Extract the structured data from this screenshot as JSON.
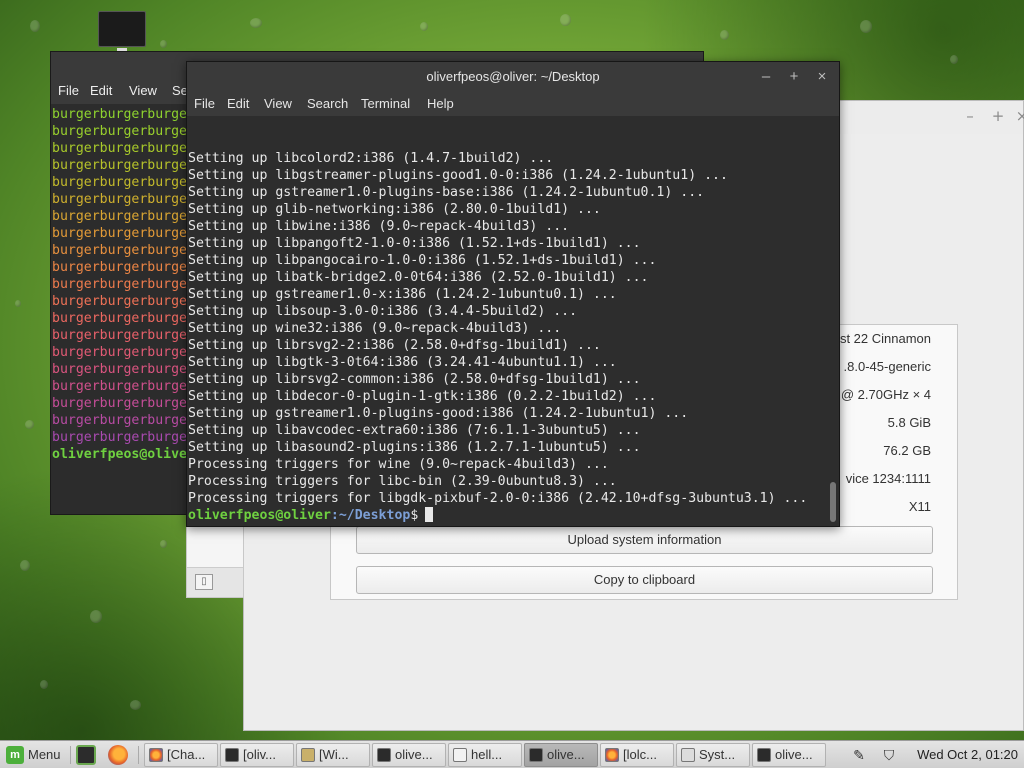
{
  "colors": {
    "accent_green": "#6fd140",
    "path_blue": "#7c9fd6",
    "terminal_bg": "#2d2d2d",
    "panel_bg": "#d9d9d9"
  },
  "sysinfo_window": {
    "rows": [
      "st 22 Cinnamon",
      ".8.0-45-generic",
      "@ 2.70GHz × 4",
      "5.8 GiB",
      "76.2 GB",
      "vice 1234:1111",
      "X11"
    ],
    "upload_label": "Upload system information",
    "copy_label": "Copy to clipboard",
    "minimize_icon": "minimize-icon",
    "maximize_icon": "maximize-icon",
    "close_icon": "close-icon"
  },
  "back_terminal": {
    "menu": [
      "File",
      "Edit",
      "View",
      "Se"
    ],
    "lines": [
      {
        "text": "burgerburgerburge",
        "color": "#8ed32f"
      },
      {
        "text": "burgerburgerburge",
        "color": "#99cf2c"
      },
      {
        "text": "burgerburgerburge",
        "color": "#a8c92a"
      },
      {
        "text": "burgerburgerburge",
        "color": "#b6c22a"
      },
      {
        "text": "burgerburgerburge",
        "color": "#c3ba2b"
      },
      {
        "text": "burgerburgerburge",
        "color": "#cfb02e"
      },
      {
        "text": "burgerburgerburge",
        "color": "#d9a532"
      },
      {
        "text": "burgerburgerburge",
        "color": "#e29a37"
      },
      {
        "text": "burgerburgerburge",
        "color": "#e8903e"
      },
      {
        "text": "burgerburgerburge",
        "color": "#ec8545"
      },
      {
        "text": "burgerburgerburge",
        "color": "#ee7b4d"
      },
      {
        "text": "burgerburgerburge",
        "color": "#ee7156"
      },
      {
        "text": "burgerburgerburge",
        "color": "#ec6860"
      },
      {
        "text": "burgerburgerburge",
        "color": "#e8606a"
      },
      {
        "text": "burgerburgerburge",
        "color": "#e25a75"
      },
      {
        "text": "burgerburgerburge",
        "color": "#da5480"
      },
      {
        "text": "burgerburgerburge",
        "color": "#d0508c"
      },
      {
        "text": "burgerburgerburge",
        "color": "#c54d98"
      },
      {
        "text": "burgerburgerburge",
        "color": "#b84ba4"
      },
      {
        "text": "burgerburgerburge",
        "color": "#a94ab0"
      }
    ],
    "prompt": "oliverfpeos@olive"
  },
  "terminal": {
    "title": "oliverfpeos@oliver: ~/Desktop",
    "menu": [
      "File",
      "Edit",
      "View",
      "Search",
      "Terminal",
      "Help"
    ],
    "lines": [
      "Setting up libcolord2:i386 (1.4.7-1build2) ...",
      "Setting up libgstreamer-plugins-good1.0-0:i386 (1.24.2-1ubuntu1) ...",
      "Setting up gstreamer1.0-plugins-base:i386 (1.24.2-1ubuntu0.1) ...",
      "Setting up glib-networking:i386 (2.80.0-1build1) ...",
      "Setting up libwine:i386 (9.0~repack-4build3) ...",
      "Setting up libpangoft2-1.0-0:i386 (1.52.1+ds-1build1) ...",
      "Setting up libpangocairo-1.0-0:i386 (1.52.1+ds-1build1) ...",
      "Setting up libatk-bridge2.0-0t64:i386 (2.52.0-1build1) ...",
      "Setting up gstreamer1.0-x:i386 (1.24.2-1ubuntu0.1) ...",
      "Setting up libsoup-3.0-0:i386 (3.4.4-5build2) ...",
      "Setting up wine32:i386 (9.0~repack-4build3) ...",
      "Setting up librsvg2-2:i386 (2.58.0+dfsg-1build1) ...",
      "Setting up libgtk-3-0t64:i386 (3.24.41-4ubuntu1.1) ...",
      "Setting up librsvg2-common:i386 (2.58.0+dfsg-1build1) ...",
      "Setting up libdecor-0-plugin-1-gtk:i386 (0.2.2-1build2) ...",
      "Setting up gstreamer1.0-plugins-good:i386 (1.24.2-1ubuntu1) ...",
      "Setting up libavcodec-extra60:i386 (7:6.1.1-3ubuntu5) ...",
      "Setting up libasound2-plugins:i386 (1.2.7.1-1ubuntu5) ...",
      "Processing triggers for wine (9.0~repack-4build3) ...",
      "Processing triggers for libc-bin (2.39-0ubuntu8.3) ...",
      "Processing triggers for libgdk-pixbuf-2.0-0:i386 (2.42.10+dfsg-3ubuntu3.1) ..."
    ],
    "prompt_user": "oliverfpeos@oliver",
    "prompt_path": ":~/Desktop",
    "prompt_symbol": "$"
  },
  "panel": {
    "menu_label": "Menu",
    "tasks": [
      {
        "label": "[Cha...",
        "icon": "firefox-icon",
        "active": false
      },
      {
        "label": "[oliv...",
        "icon": "terminal-icon",
        "active": false
      },
      {
        "label": "[Wi...",
        "icon": "wine-icon",
        "active": false
      },
      {
        "label": "olive...",
        "icon": "terminal-icon",
        "active": false
      },
      {
        "label": "hell...",
        "icon": "text-editor-icon",
        "active": false
      },
      {
        "label": "olive...",
        "icon": "terminal-icon",
        "active": true
      },
      {
        "label": "[lolc...",
        "icon": "firefox-icon",
        "active": false
      },
      {
        "label": "Syst...",
        "icon": "system-info-icon",
        "active": false
      },
      {
        "label": "olive...",
        "icon": "terminal-icon",
        "active": false
      }
    ],
    "clock": "Wed Oct  2, 01:20"
  }
}
